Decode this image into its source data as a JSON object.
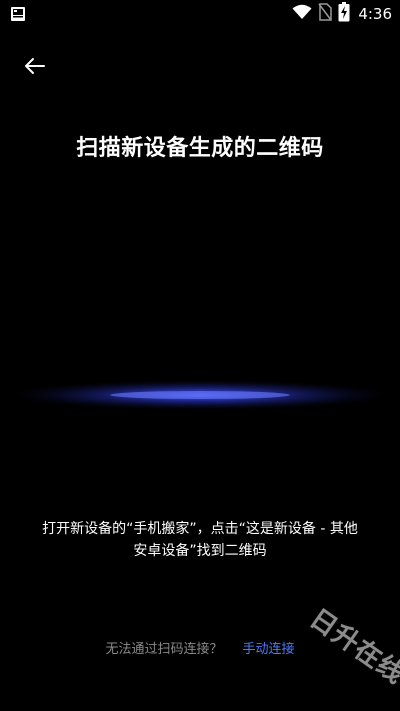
{
  "status_bar": {
    "time": "4:36",
    "icons": [
      "notification-icon",
      "wifi-icon",
      "no-sim-icon",
      "battery-charging-icon"
    ]
  },
  "header": {
    "back_icon": "arrow-left-icon",
    "title": "扫描新设备生成的二维码"
  },
  "instruction": {
    "line1": "打开新设备的“手机搬家”，点击“这是新设备 - 其他",
    "line2": "安卓设备”找到二维码"
  },
  "footer": {
    "question": "无法通过扫码连接？",
    "manual_link": "手动连接"
  },
  "watermark": {
    "text": "日升在线"
  },
  "colors": {
    "background": "#000000",
    "text": "#ffffff",
    "link": "#4a7bff",
    "muted": "#8a8a8a",
    "glow": "#3b4dff"
  }
}
